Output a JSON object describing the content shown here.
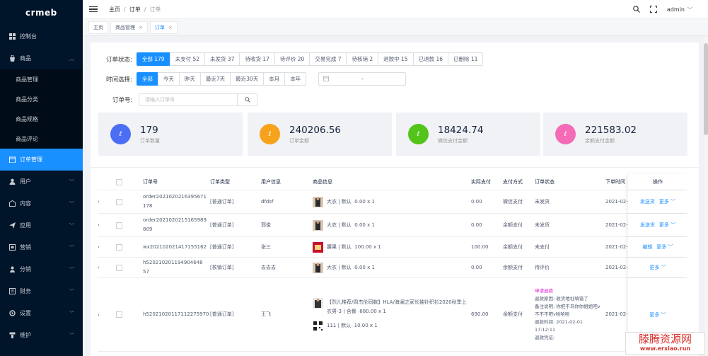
{
  "app": {
    "logo": "crmeb"
  },
  "sidebar": {
    "items": [
      {
        "label": "控制台",
        "icon": "dashboard-icon"
      },
      {
        "label": "商品",
        "icon": "shop-icon",
        "expanded": true
      },
      {
        "label": "订单管理",
        "icon": "order-icon",
        "active": true
      },
      {
        "label": "用户",
        "icon": "user-icon"
      },
      {
        "label": "内容",
        "icon": "content-icon"
      },
      {
        "label": "应用",
        "icon": "app-icon"
      },
      {
        "label": "营销",
        "icon": "marketing-icon"
      },
      {
        "label": "分销",
        "icon": "distribution-icon"
      },
      {
        "label": "财务",
        "icon": "finance-icon"
      },
      {
        "label": "设置",
        "icon": "settings-icon"
      },
      {
        "label": "维护",
        "icon": "maintain-icon"
      }
    ],
    "sub_items": [
      "商品管理",
      "商品分类",
      "商品规格",
      "商品评论"
    ]
  },
  "header": {
    "breadcrumb": [
      "主页",
      "订单",
      "订单"
    ],
    "user": "admin"
  },
  "tabs": [
    {
      "label": "主页",
      "closable": false
    },
    {
      "label": "商品管理",
      "closable": true
    },
    {
      "label": "订单",
      "closable": true,
      "active": true
    }
  ],
  "filters": {
    "status_label": "订单状态:",
    "status_options": [
      "全部 179",
      "未支付 52",
      "未发货 37",
      "待收货 17",
      "待评价 20",
      "交易完成 7",
      "待核销 2",
      "退款中 15",
      "已退款 16",
      "已删除 11"
    ],
    "status_selected": "全部 179",
    "time_label": "时间选择:",
    "time_options": [
      "全部",
      "今天",
      "昨天",
      "最近7天",
      "最近30天",
      "本月",
      "本年"
    ],
    "time_selected": "全部",
    "date_range_sep": "-",
    "order_no_label": "订单号:",
    "order_no_placeholder": "请输入订单号"
  },
  "stats": [
    {
      "value": "179",
      "label": "订单数量",
      "color": "#4c6ef5"
    },
    {
      "value": "240206.56",
      "label": "订单金额",
      "color": "#f7a21d"
    },
    {
      "value": "18424.74",
      "label": "微信支付金额",
      "color": "#52c41a"
    },
    {
      "value": "221583.02",
      "label": "余额支付金额",
      "color": "#f56bb8"
    }
  ],
  "table": {
    "columns": [
      "订单号",
      "订单类型",
      "用户信息",
      "商品信息",
      "实际支付",
      "支付方式",
      "订单状态",
      "下单时间",
      "操作"
    ],
    "rows": [
      {
        "order_no": "order2021020216395671178",
        "type": "[普通订单]",
        "user": "dfdsf",
        "goods": [
          {
            "name": "大衣 | 默认",
            "price": "0.00 x 1"
          }
        ],
        "paid": "0.00",
        "pay_method": "微信支付",
        "status": "未发货",
        "time": "2021-02-0",
        "ops": [
          "发送货",
          "更多"
        ]
      },
      {
        "order_no": "order2021020215165989809",
        "type": "[普通订单]",
        "user": "郭俊",
        "goods": [
          {
            "name": "大衣 | 默认",
            "price": "0.00 x 1"
          }
        ],
        "paid": "0.00",
        "pay_method": "余额支付",
        "status": "未发货",
        "time": "2021-02-0",
        "ops": [
          "发送货",
          "更多"
        ]
      },
      {
        "order_no": "wx202102021417155162",
        "type": "[普通订单]",
        "user": "张三",
        "goods": [
          {
            "name": "腰果 | 默认",
            "price": "100.00 x 1"
          }
        ],
        "paid": "100.00",
        "pay_method": "余额支付",
        "status": "未支付",
        "time": "2021-02-0",
        "ops": [
          "编辑",
          "更多"
        ]
      },
      {
        "order_no": "h520210201194904648 57",
        "type": "[核销订单]",
        "user": "去去去",
        "goods": [
          {
            "name": "大衣 | 默认",
            "price": "0.00 x 1"
          }
        ],
        "paid": "0.00",
        "pay_method": "余额支付",
        "status": "待评价",
        "time": "2021-02-0",
        "ops": [
          "更多"
        ]
      },
      {
        "order_no": "h52021020117112275970",
        "type": "[普通订单]",
        "user": "王飞",
        "goods": [
          {
            "name": "【烈儿推荐/周杰伦同款】HLA/海澜之家长袖针织衫2020秋季上衣男-3 | 含餐",
            "price": "680.00 x 1"
          },
          {
            "name": "111 | 默认",
            "price": "10.00 x 1"
          }
        ],
        "paid": "690.00",
        "pay_method": "余额支付",
        "status_title": "申请退款",
        "status_lines": [
          "退款原因: 收货地址填错了",
          "备注说明: 你把不鸟你你姐姐吧v不不不吧v哈哈哈",
          "退款时间: 2021-02-01 17:12:11",
          "退款凭证:"
        ],
        "time": "2021-02-0",
        "ops": [
          "更多"
        ]
      }
    ]
  },
  "watermark": {
    "cn": "滕腾资源网",
    "url": "www.erxiao.run"
  }
}
